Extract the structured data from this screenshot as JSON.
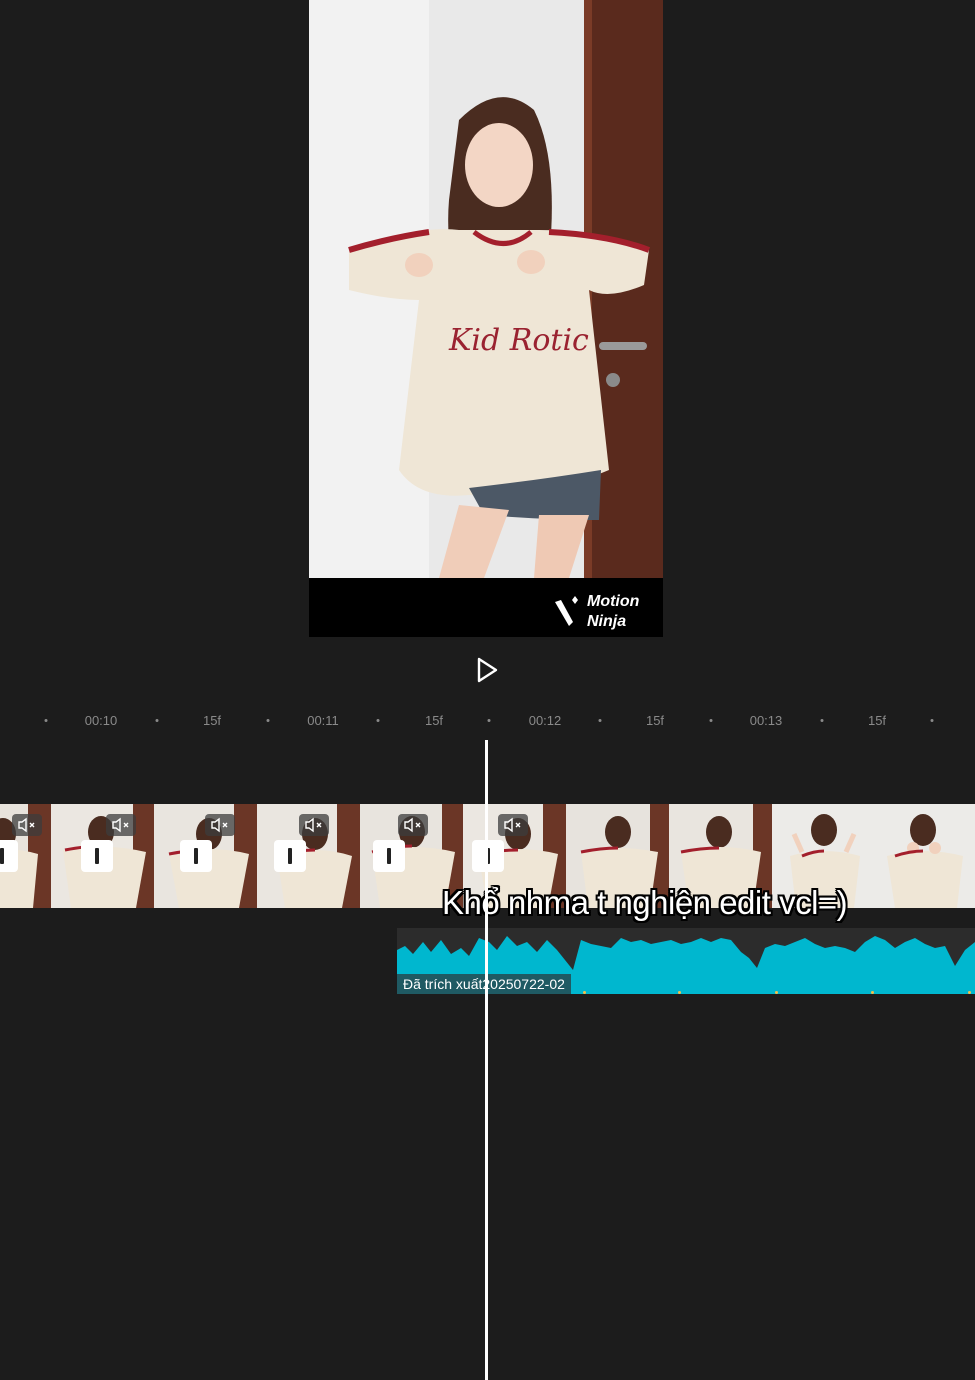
{
  "preview": {
    "watermark": {
      "line1": "Motion",
      "line2": "Ninja"
    }
  },
  "ruler": {
    "labels": [
      "00:10",
      "15f",
      "00:11",
      "15f",
      "00:12",
      "15f",
      "00:13",
      "15f"
    ]
  },
  "caption": {
    "text": "Khổ nhma t nghiện edit vcl=)"
  },
  "audio": {
    "clip_label": "Đã trích xuất20250722-02"
  },
  "colors": {
    "background": "#1c1c1c",
    "waveform": "#00b7cf",
    "audio_label_bg": "#1f5a63",
    "playhead": "#ffffff",
    "beat_marker": "#f1c04a"
  },
  "icons": {
    "play": "play-icon",
    "mute": "muted-speaker-icon",
    "watermark": "motion-ninja-logo-icon"
  }
}
